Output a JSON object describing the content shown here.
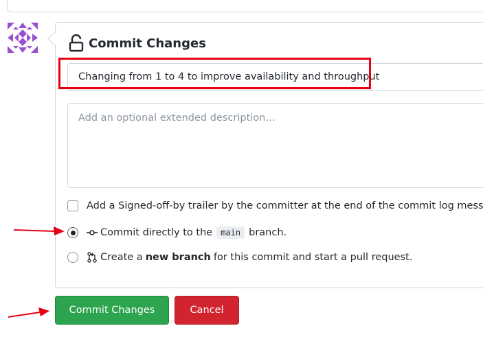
{
  "commit_panel": {
    "title": "Commit Changes",
    "summary_value": "Changing from 1 to 4 to improve availability and throughput",
    "description_placeholder": "Add an optional extended description…",
    "signoff_label": "Add a Signed-off-by trailer by the committer at the end of the commit log message.",
    "signoff_checked": false,
    "options": {
      "direct": {
        "prefix": "Commit directly to the",
        "branch": "main",
        "suffix": "branch.",
        "selected": true
      },
      "new_branch": {
        "prefix": "Create a",
        "bold": "new branch",
        "suffix": "for this commit and start a pull request.",
        "selected": false
      }
    }
  },
  "buttons": {
    "commit": "Commit Changes",
    "cancel": "Cancel"
  },
  "colors": {
    "highlight": "#e60012",
    "commit_button": "#2da44e",
    "cancel_button": "#d1242f",
    "avatar": "#9b4fd1",
    "annotation_arrow": "#e60012"
  },
  "icons": [
    "identicon-avatar",
    "unlock-icon",
    "git-commit-icon",
    "git-pull-request-icon",
    "annotation-arrow"
  ]
}
